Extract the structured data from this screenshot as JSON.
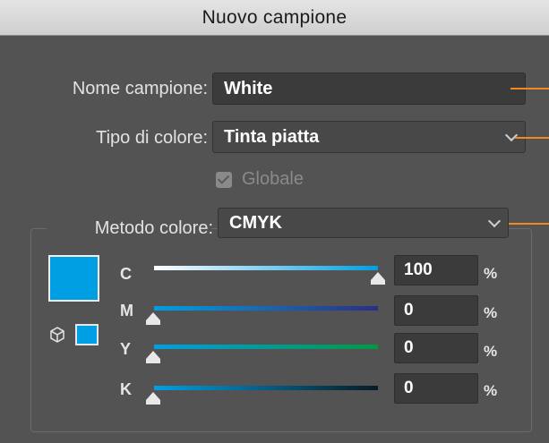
{
  "dialog": {
    "title": "Nuovo campione"
  },
  "swatch_name": {
    "label": "Nome campione:",
    "value": "White"
  },
  "color_type": {
    "label": "Tipo di colore:",
    "value": "Tinta piatta"
  },
  "global": {
    "label": "Globale",
    "checked": true,
    "enabled": false
  },
  "color_mode": {
    "label": "Metodo colore:",
    "value": "CMYK"
  },
  "swatch_color": "#009fe3",
  "channels": [
    {
      "name": "C",
      "value": "100",
      "unit": "%",
      "level": 1.0
    },
    {
      "name": "M",
      "value": "0",
      "unit": "%",
      "level": 0.0
    },
    {
      "name": "Y",
      "value": "0",
      "unit": "%",
      "level": 0.0
    },
    {
      "name": "K",
      "value": "0",
      "unit": "%",
      "level": 0.0
    }
  ],
  "accent_color": "#f08a1c"
}
